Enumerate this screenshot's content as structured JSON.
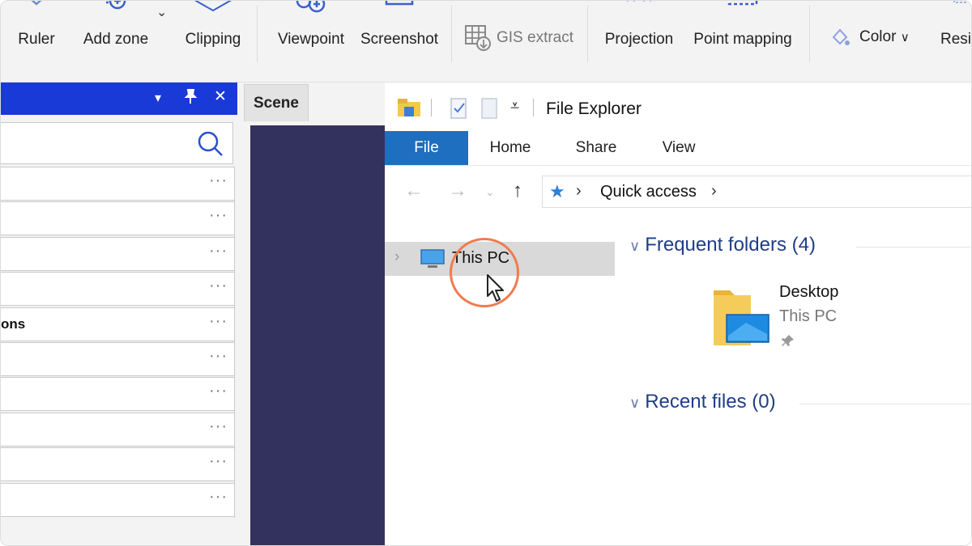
{
  "toolbar": {
    "items": [
      {
        "label": "Ruler",
        "icon": "ruler-icon"
      },
      {
        "label": "Add zone",
        "icon": "add-zone-icon"
      },
      {
        "label": "Clipping",
        "icon": "clipping-icon"
      },
      {
        "label": "Viewpoint",
        "icon": "viewpoint-icon"
      },
      {
        "label": "Screenshot",
        "icon": "screenshot-icon"
      },
      {
        "label": "GIS extract",
        "icon": "gis-extract-icon"
      },
      {
        "label": "Projection",
        "icon": "projection-icon"
      },
      {
        "label": "Point mapping",
        "icon": "point-mapping-icon"
      },
      {
        "label": "Color",
        "icon": "color-icon"
      },
      {
        "label": "Resi",
        "icon": "resize-icon"
      }
    ]
  },
  "left_panel": {
    "header_controls": [
      "▾",
      "pin-icon",
      "✕"
    ],
    "rows": [
      {
        "text": "",
        "more": "···"
      },
      {
        "text": "",
        "more": "···"
      },
      {
        "text": "",
        "more": "···"
      },
      {
        "text": "",
        "more": "···"
      },
      {
        "text": "ons",
        "more": "···"
      },
      {
        "text": "",
        "more": "···"
      },
      {
        "text": "",
        "more": "···"
      },
      {
        "text": "",
        "more": "···"
      },
      {
        "text": "",
        "more": "···"
      },
      {
        "text": "",
        "more": "···"
      }
    ]
  },
  "scene": {
    "tab_label": "Scene"
  },
  "file_explorer": {
    "title": "File Explorer",
    "tabs": [
      {
        "label": "File",
        "active": true
      },
      {
        "label": "Home",
        "active": false
      },
      {
        "label": "Share",
        "active": false
      },
      {
        "label": "View",
        "active": false
      }
    ],
    "address": {
      "crumb": "Quick access"
    },
    "tree": {
      "selected": "This PC"
    },
    "sections": {
      "frequent": "Frequent folders (4)",
      "recent": "Recent files (0)"
    },
    "frequent_items": [
      {
        "name": "Desktop",
        "location": "This PC",
        "pinned": true
      }
    ]
  },
  "colors": {
    "accent": "#1a3ad7",
    "file_tab": "#1e6fbf",
    "scene_bg": "#33325f",
    "cursor_ring": "#f07b4f"
  }
}
